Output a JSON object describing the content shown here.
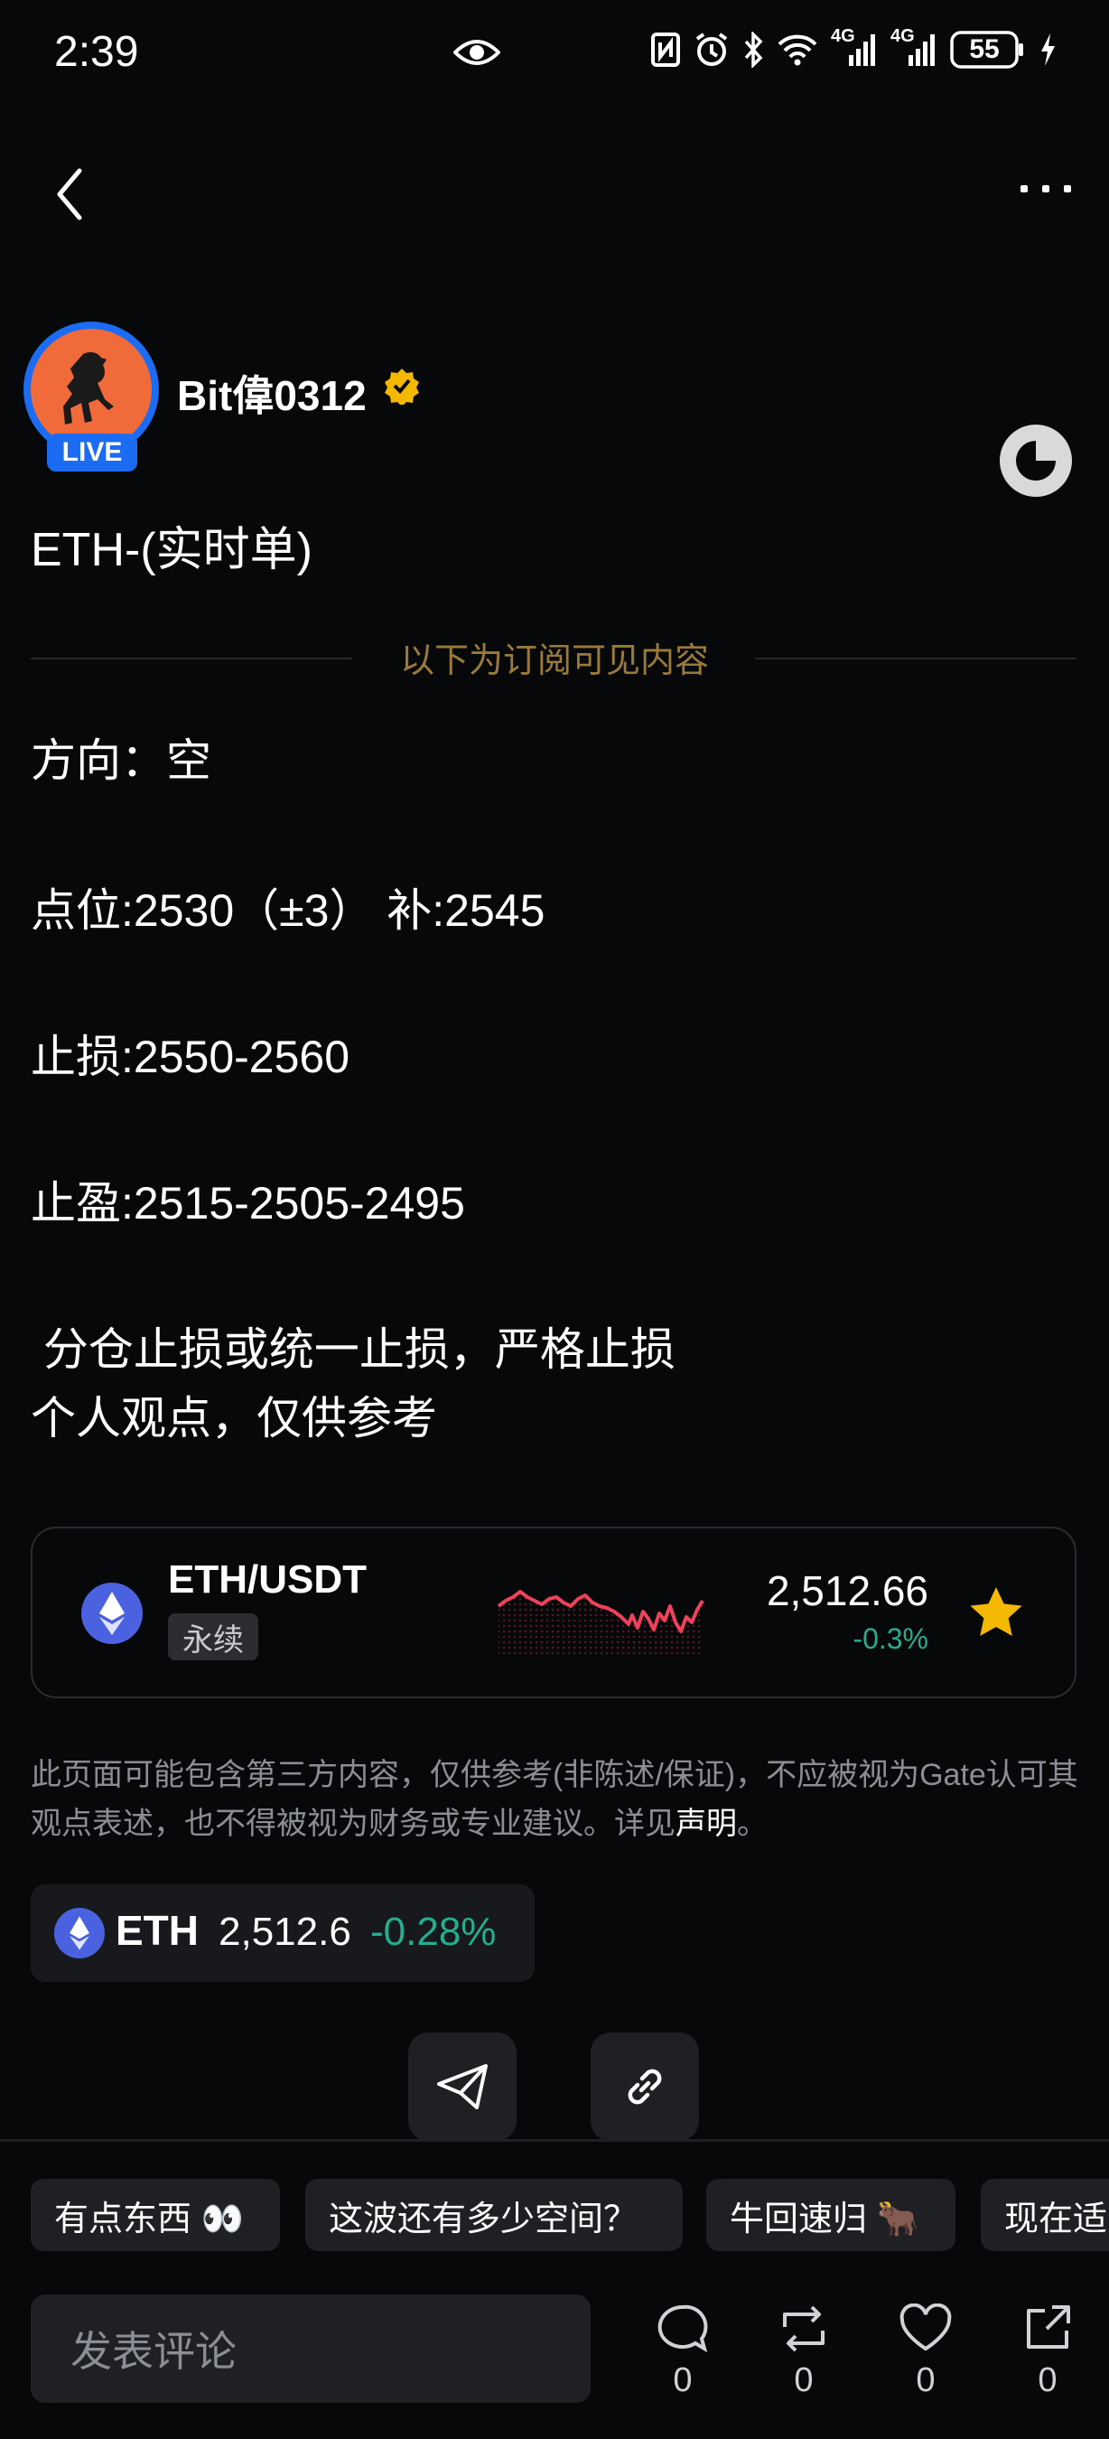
{
  "status_bar": {
    "time": "2:39",
    "network_1": "4G",
    "network_2": "4G",
    "battery": "55"
  },
  "author": {
    "name": "Bit偉0312",
    "badge": "LIVE"
  },
  "post": {
    "title": "ETH-(实时单)",
    "divider_text": "以下为订阅可见内容",
    "lines": [
      "方向：空",
      "点位:2530（±3） 补:2545",
      "止损:2550-2560",
      "止盈:2515-2505-2495",
      " 分仓止损或统一止损，严格止损",
      "个人观点，仅供参考"
    ]
  },
  "ticker_card": {
    "pair": "ETH/USDT",
    "type": "永续",
    "price": "2,512.66",
    "change": "-0.3%",
    "sparkline_color": "#f0415c"
  },
  "disclaimer": {
    "text": "此页面可能包含第三方内容，仅供参考(非陈述/保证)，不应被视为Gate认可其观点表述，也不得被视为财务或专业建议。详见",
    "link": "声明",
    "end": "。"
  },
  "eth_chip": {
    "label": "ETH",
    "price": "2,512.6",
    "change": "-0.28%"
  },
  "tags": [
    "有点东西 👀",
    "这波还有多少空间？",
    "牛回速归 🐂",
    "现在适"
  ],
  "comment": {
    "placeholder": "发表评论"
  },
  "actions": {
    "comments": "0",
    "reposts": "0",
    "likes": "0",
    "shares": "0"
  },
  "colors": {
    "background": "#070809",
    "up_green": "#24ae8f",
    "accent_blue": "#1b6cf2",
    "gold": "#f5b800"
  }
}
